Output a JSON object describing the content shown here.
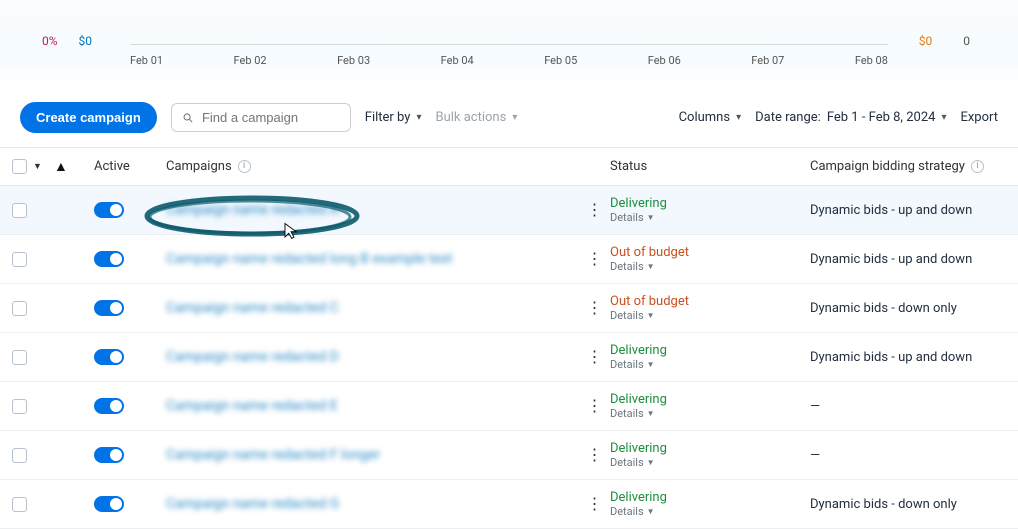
{
  "chart_data": {
    "type": "line",
    "categories": [
      "Feb 01",
      "Feb 02",
      "Feb 03",
      "Feb 04",
      "Feb 05",
      "Feb 06",
      "Feb 07",
      "Feb 08"
    ],
    "series": [],
    "left_axis_labels": {
      "percent": "0%",
      "dollar": "$0"
    },
    "right_axis_labels": {
      "dollar": "$0",
      "number": "0"
    },
    "ylim": [
      0,
      0
    ]
  },
  "toolbar": {
    "create_label": "Create campaign",
    "search_placeholder": "Find a campaign",
    "filter_label": "Filter by",
    "bulk_label": "Bulk actions",
    "columns_label": "Columns",
    "date_prefix": "Date range:",
    "date_value": "Feb 1 - Feb 8, 2024",
    "export_label": "Export"
  },
  "columns": {
    "active": "Active",
    "campaigns": "Campaigns",
    "status": "Status",
    "bidding": "Campaign bidding strategy"
  },
  "status_labels": {
    "delivering": "Delivering",
    "out_of_budget": "Out of budget",
    "details": "Details"
  },
  "bidding_labels": {
    "up_down": "Dynamic bids - up and down",
    "down_only": "Dynamic bids - down only",
    "none": "—"
  },
  "rows": [
    {
      "name": "Campaign name redacted A",
      "status": "delivering",
      "bidding": "up_down"
    },
    {
      "name": "Campaign name redacted long B example text",
      "status": "out_of_budget",
      "bidding": "up_down"
    },
    {
      "name": "Campaign name redacted C",
      "status": "out_of_budget",
      "bidding": "down_only"
    },
    {
      "name": "Campaign name redacted D",
      "status": "delivering",
      "bidding": "up_down"
    },
    {
      "name": "Campaign name redacted E",
      "status": "delivering",
      "bidding": "none"
    },
    {
      "name": "Campaign name redacted F longer",
      "status": "delivering",
      "bidding": "none"
    },
    {
      "name": "Campaign name redacted G",
      "status": "delivering",
      "bidding": "down_only"
    }
  ]
}
